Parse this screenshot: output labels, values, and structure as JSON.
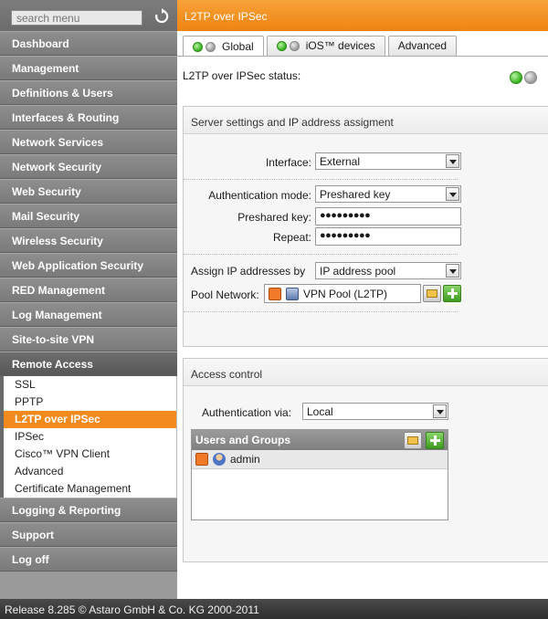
{
  "sidebar": {
    "search_placeholder": "search menu",
    "items_top": [
      "Dashboard",
      "Management",
      "Definitions & Users",
      "Interfaces & Routing",
      "Network Services",
      "Network Security",
      "Web Security",
      "Mail Security",
      "Wireless Security",
      "Web Application Security",
      "RED Management",
      "Log Management",
      "Site-to-site VPN"
    ],
    "open_section": "Remote Access",
    "sub_items": [
      "SSL",
      "PPTP",
      "L2TP over IPSec",
      "IPSec",
      "Cisco™ VPN Client",
      "Advanced",
      "Certificate Management"
    ],
    "items_bottom": [
      "Logging & Reporting",
      "Support",
      "Log off"
    ]
  },
  "main": {
    "title": "L2TP over IPSec",
    "tabs": [
      "Global",
      "iOS™ devices",
      "Advanced"
    ],
    "status_label": "L2TP over IPSec status:",
    "server_panel": {
      "heading": "Server settings and IP address assigment",
      "interface_label": "Interface:",
      "interface_value": "External",
      "auth_mode_label": "Authentication mode:",
      "auth_mode_value": "Preshared key",
      "preshared_label": "Preshared key:",
      "preshared_value": "●●●●●●●●●",
      "repeat_label": "Repeat:",
      "repeat_value": "●●●●●●●●●",
      "assign_label": "Assign IP addresses by",
      "assign_value": "IP address pool",
      "pool_label": "Pool Network:",
      "pool_value": "VPN Pool (L2TP)"
    },
    "access_panel": {
      "heading": "Access control",
      "auth_via_label": "Authentication via:",
      "auth_via_value": "Local",
      "users_heading": "Users and Groups",
      "users": [
        "admin"
      ]
    }
  },
  "footer": {
    "text": "Release 8.285  © Astaro GmbH & Co. KG 2000-2011"
  },
  "colors": {
    "accent": "#f28a1e",
    "sidebar": "#8e8e8e",
    "footer": "#3a3a3a"
  }
}
